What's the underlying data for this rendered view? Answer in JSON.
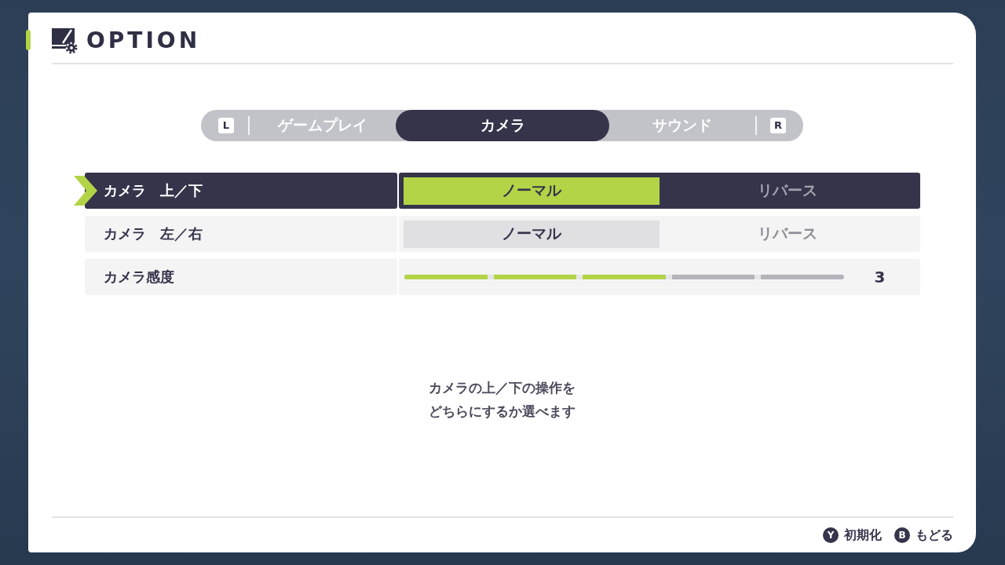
{
  "header": {
    "title": "OPTION"
  },
  "tab_bar": {
    "prev_key": "L",
    "next_key": "R",
    "tabs": [
      {
        "label": "ゲームプレイ",
        "selected": false
      },
      {
        "label": "カメラ",
        "selected": true
      },
      {
        "label": "サウンド",
        "selected": false
      }
    ]
  },
  "settings": [
    {
      "kind": "choice",
      "label": "カメラ　上／下",
      "focused": true,
      "options": [
        {
          "label": "ノーマル",
          "selected": true
        },
        {
          "label": "リバース",
          "selected": false
        }
      ]
    },
    {
      "kind": "choice",
      "label": "カメラ　左／右",
      "focused": false,
      "options": [
        {
          "label": "ノーマル",
          "selected": true
        },
        {
          "label": "リバース",
          "selected": false
        }
      ]
    },
    {
      "kind": "slider",
      "label": "カメラ感度",
      "focused": false,
      "level": 0.6,
      "reading": "3"
    }
  ],
  "description": "カメラの上／下の操作をどちらにするか選べます",
  "footer": {
    "actions": [
      {
        "key": "Y",
        "label": "初期化"
      },
      {
        "key": "B",
        "label": "もどる"
      }
    ]
  }
}
